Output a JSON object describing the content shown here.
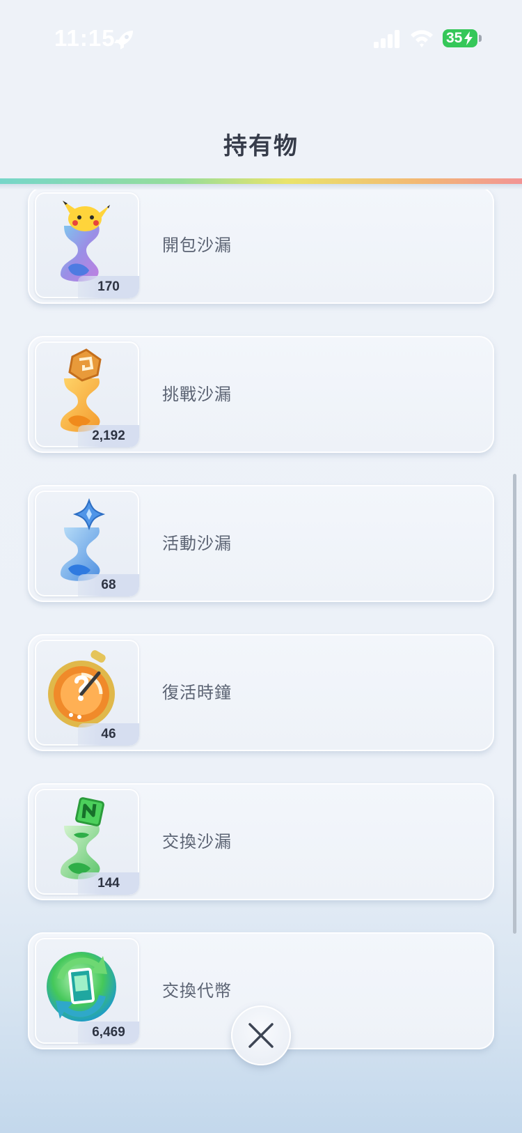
{
  "status_bar": {
    "time": "11:15",
    "battery_level": "35",
    "icons": [
      "rocket-icon",
      "signal-icon",
      "wifi-icon",
      "battery-charging-icon"
    ]
  },
  "header": {
    "title": "持有物"
  },
  "items": [
    {
      "name": "開包沙漏",
      "count": "170",
      "icon": "pack-hourglass-icon"
    },
    {
      "name": "挑戰沙漏",
      "count": "2,192",
      "icon": "challenge-hourglass-icon"
    },
    {
      "name": "活動沙漏",
      "count": "68",
      "icon": "event-hourglass-icon"
    },
    {
      "name": "復活時鐘",
      "count": "46",
      "icon": "revival-clock-icon"
    },
    {
      "name": "交換沙漏",
      "count": "144",
      "icon": "trade-hourglass-icon"
    },
    {
      "name": "交換代幣",
      "count": "6,469",
      "icon": "trade-token-icon"
    }
  ],
  "colors": {
    "accent_blue": "#6b8fd8",
    "accent_green": "#35c759",
    "rainbow": [
      "#69d3c4",
      "#8ddb8f",
      "#e9e25b",
      "#f3b265",
      "#f38a8a"
    ]
  },
  "close_button": {
    "icon": "close-icon"
  }
}
